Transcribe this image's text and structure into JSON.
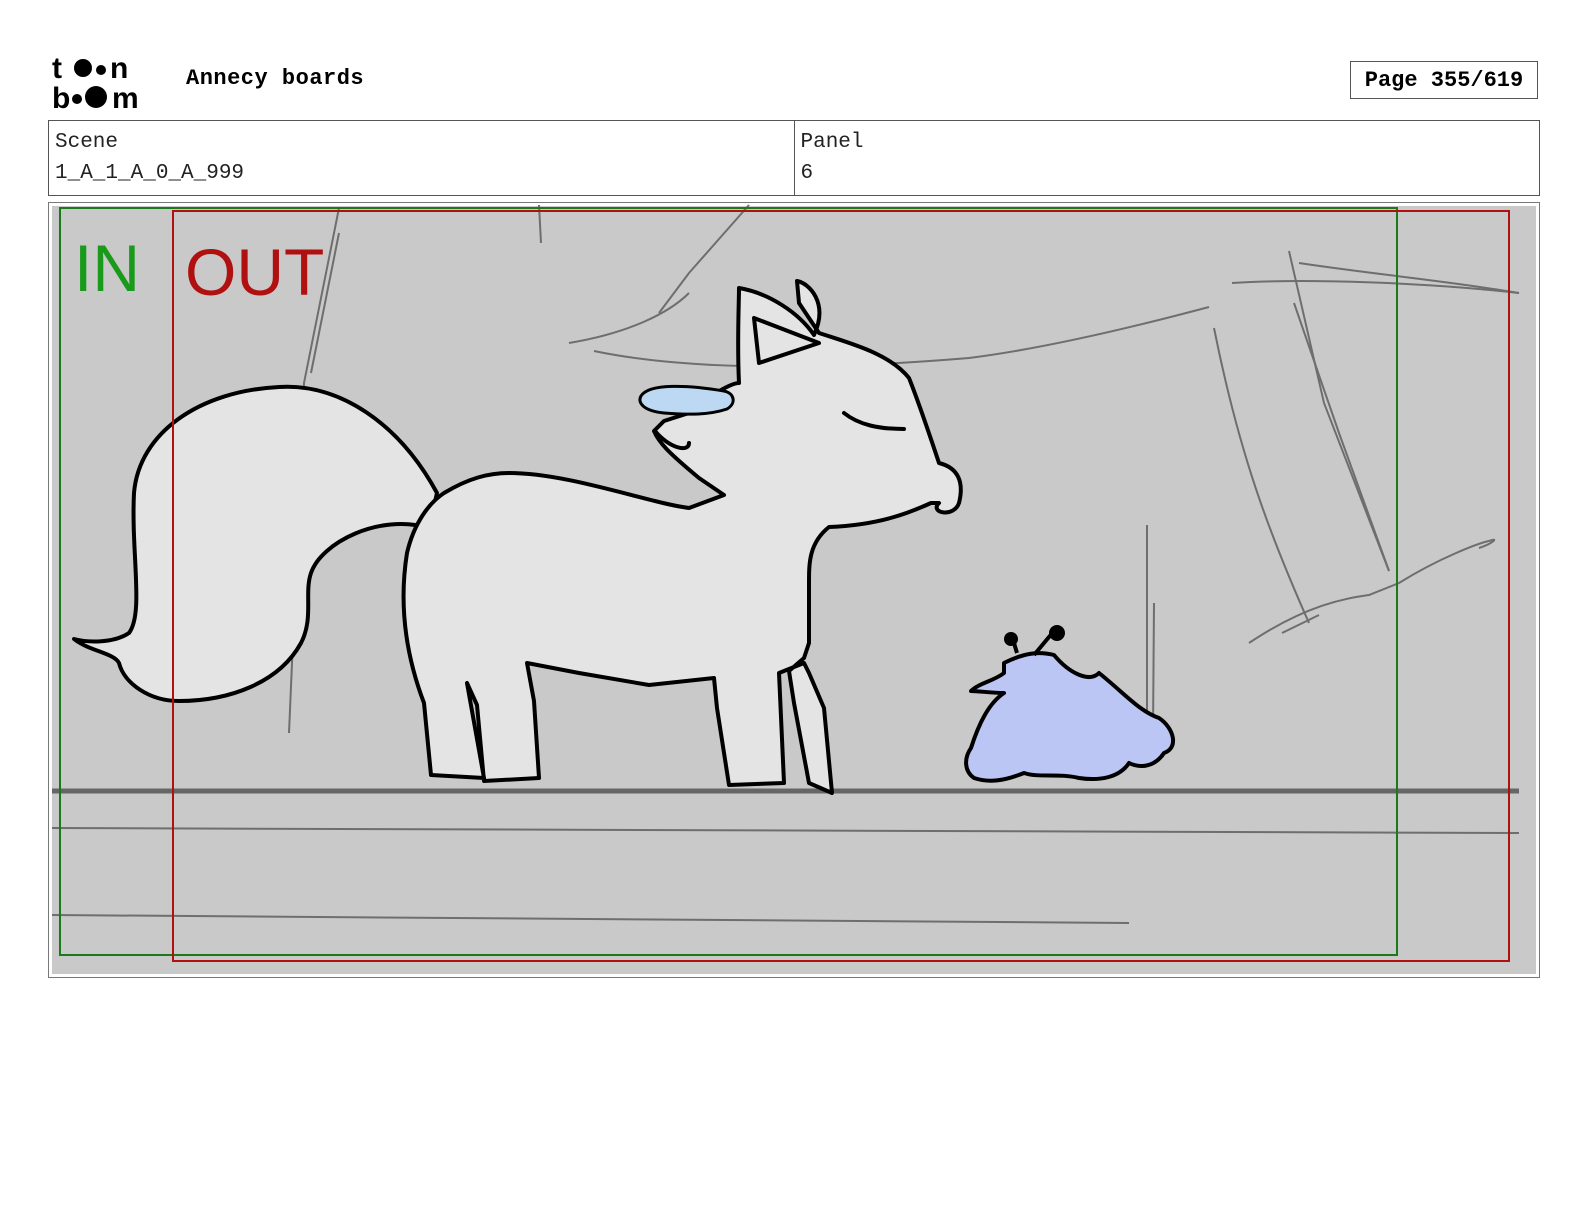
{
  "header": {
    "logo_text_top": "toon",
    "logo_text_bottom": "boom",
    "title": "Annecy boards",
    "page_label": "Page 355/619"
  },
  "info": {
    "scene_label": "Scene",
    "scene_value": "1_A_1_A_0_A_999",
    "panel_label": "Panel",
    "panel_value": "6"
  },
  "frame": {
    "in_label": "IN",
    "out_label": "OUT",
    "in_color": "#1a9a1a",
    "out_color": "#b01010"
  }
}
